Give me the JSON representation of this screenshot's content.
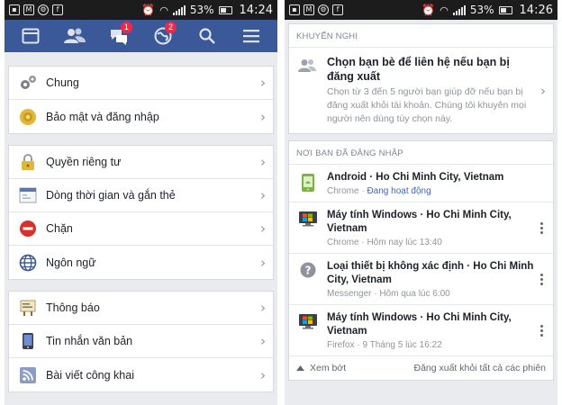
{
  "left": {
    "status_bar": {
      "battery": "53%",
      "time": "14:24"
    },
    "tab_bar": {
      "tabs": [
        {
          "icon": "news-feed-icon"
        },
        {
          "icon": "friends-icon"
        },
        {
          "icon": "messages-icon",
          "badge": "1"
        },
        {
          "icon": "notifications-globe-icon",
          "badge": "2"
        },
        {
          "icon": "search-icon"
        },
        {
          "icon": "menu-icon"
        }
      ]
    },
    "groups": [
      [
        {
          "icon": "gears-icon",
          "label": "Chung"
        },
        {
          "icon": "security-badge-icon",
          "label": "Bảo mật và đăng nhập"
        }
      ],
      [
        {
          "icon": "lock-icon",
          "label": "Quyền riêng tư"
        },
        {
          "icon": "timeline-icon",
          "label": "Dòng thời gian và gắn thẻ"
        },
        {
          "icon": "block-icon",
          "label": "Chặn"
        },
        {
          "icon": "globe-icon",
          "label": "Ngôn ngữ"
        }
      ],
      [
        {
          "icon": "notice-board-icon",
          "label": "Thông báo"
        },
        {
          "icon": "phone-icon",
          "label": "Tin nhắn văn bản"
        },
        {
          "icon": "rss-icon",
          "label": "Bài viết công khai"
        }
      ]
    ]
  },
  "right": {
    "status_bar": {
      "battery": "53%",
      "time": "14:26"
    },
    "recommended": {
      "header": "KHUYẾN NGHỊ",
      "title": "Chọn bạn bè để liên hệ nếu bạn bị đăng xuất",
      "description": "Chọn từ 3 đến 5 người bạn giúp đỡ nếu bạn bị đăng xuất khỏi tài khoản. Chúng tôi khuyên mọi người nên dùng tùy chọn này."
    },
    "logged_in": {
      "header": "NƠI BẠN ĐÃ ĐĂNG NHẬP",
      "sessions": [
        {
          "icon": "android-phone-icon",
          "title": "Android · Ho Chi Minh City, Vietnam",
          "client": "Chrome · ",
          "status": "Đang hoạt động"
        },
        {
          "icon": "windows-computer-icon",
          "title": "Máy tính Windows · Ho Chi Minh City, Vietnam",
          "client": "Chrome · Hôm nay lúc 13:40"
        },
        {
          "icon": "unknown-device-icon",
          "title": "Loại thiết bị không xác định · Ho Chi Minh City, Vietnam",
          "client": "Messenger · Hôm qua lúc 6:00"
        },
        {
          "icon": "windows-computer-icon",
          "title": "Máy tính Windows · Ho Chi Minh City, Vietnam",
          "client": "Firefox · 9 Tháng 5 lúc 16:22"
        }
      ],
      "see_less": "Xem bớt",
      "logout_all": "Đăng xuất khỏi tất cả các phiên"
    }
  }
}
